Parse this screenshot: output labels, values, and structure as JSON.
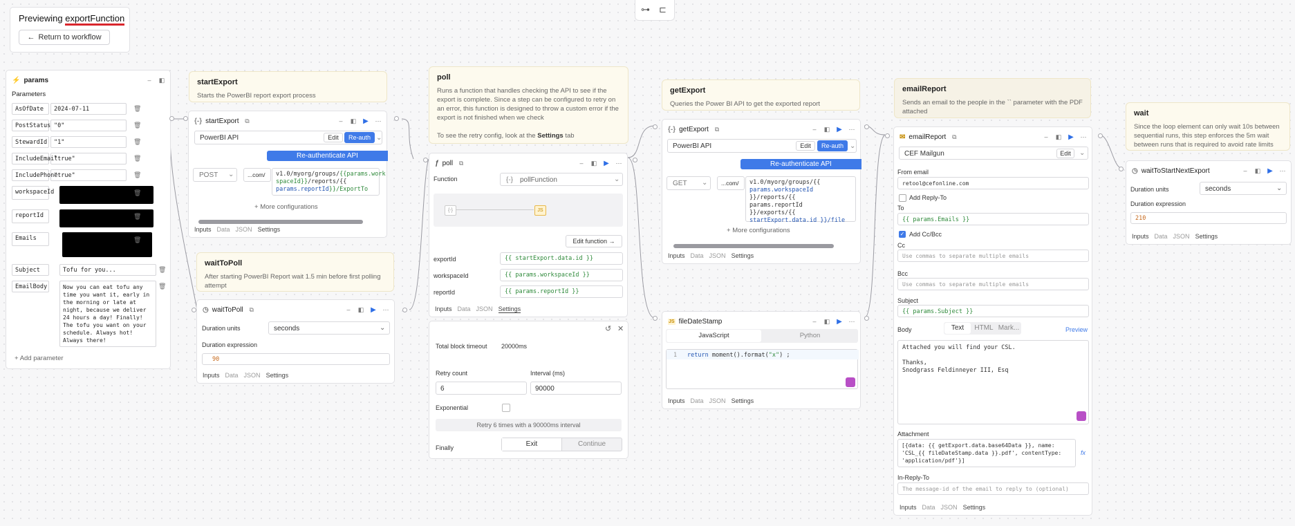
{
  "header": {
    "previewing_label": "Previewing",
    "function_name": "exportFunction",
    "return_label": "Return to workflow"
  },
  "params": {
    "title": "params",
    "section": "Parameters",
    "rows": [
      {
        "key": "AsOfDate",
        "value": "2024-07-11"
      },
      {
        "key": "PostStatus",
        "value": "\"0\""
      },
      {
        "key": "StewardId",
        "value": "\"1\""
      },
      {
        "key": "IncludeEmail",
        "value": "\"true\""
      },
      {
        "key": "IncludePhone",
        "value": "\"true\""
      },
      {
        "key": "workspaceId",
        "value": ""
      },
      {
        "key": "reportId",
        "value": ""
      },
      {
        "key": "Emails",
        "value": ""
      },
      {
        "key": "Subject",
        "value": "Tofu for you..."
      },
      {
        "key": "EmailBody",
        "value": "Now you can eat tofu any time you want it, early in the morning or late at night, because we deliver 24 hours a day! Finally! The tofu you want on your schedule. Always hot! Always there!"
      }
    ],
    "add_param": "Add parameter"
  },
  "notes": {
    "startExport": {
      "title": "startExport",
      "text": "Starts the PowerBI report export process"
    },
    "waitToPoll": {
      "title": "waitToPoll",
      "text": "After starting PowerBI Report wait 1.5 min before first polling attempt"
    },
    "poll": {
      "title": "poll",
      "text": "Runs a function that handles checking the API to see if the export is complete. Since a step can be configured to retry on an error, this function is designed to throw a custom error if the export is not finished when we check\n\nTo see the retry config, look at the"
    },
    "poll_settings_word": "Settings",
    "poll_tab_word": "tab",
    "getExport": {
      "title": "getExport",
      "text": "Queries the Power BI API to get the exported report"
    },
    "emailReport": {
      "title": "emailReport",
      "text": "Sends an email to the people in the `` parameter with the PDF attached"
    },
    "wait": {
      "title": "wait",
      "text": "Since the loop element can only wait 10s between sequential runs, this step enforces the 5m wait between runs that is required to avoid rate limits"
    }
  },
  "startExport": {
    "title": "startExport",
    "resource": "PowerBI API",
    "edit": "Edit",
    "reauth": "Re-auth",
    "banner": "Re-authenticate API",
    "method": "POST",
    "base": "...com/",
    "url_a": "v1.0/myorg/groups/",
    "url_b": "{{params.work",
    "url_c": "spaceId}}",
    "url_d": "/reports/{{",
    "url_e": "params.reportId",
    "url_f": "}}/ExportTo",
    "more": "More configurations",
    "tabs": [
      "Inputs",
      "Data",
      "JSON",
      "Settings"
    ]
  },
  "waitToPoll": {
    "title": "waitToPoll",
    "units_label": "Duration units",
    "units_value": "seconds",
    "expr_label": "Duration expression",
    "expr_value": "90",
    "tabs": [
      "Inputs",
      "Data",
      "JSON",
      "Settings"
    ]
  },
  "poll": {
    "title": "poll",
    "function_label": "Function",
    "function_value": "pollFunction",
    "edit_function": "Edit function",
    "rows": [
      {
        "label": "exportId",
        "value": "{{ startExport.data.id }}"
      },
      {
        "label": "workspaceId",
        "value": "{{ params.workspaceId }}"
      },
      {
        "label": "reportId",
        "value": "{{ params.reportId }}"
      }
    ],
    "tabs": [
      "Inputs",
      "Data",
      "JSON",
      "Settings"
    ]
  },
  "retry": {
    "timeout_label": "Total block timeout",
    "timeout_value": "20000ms",
    "count_label": "Retry count",
    "count_value": "6",
    "interval_label": "Interval (ms)",
    "interval_value": "90000",
    "exponential_label": "Exponential",
    "summary": "Retry 6 times with a 90000ms interval",
    "finally_label": "Finally",
    "exit": "Exit",
    "continue": "Continue"
  },
  "getExport": {
    "title": "getExport",
    "resource": "PowerBI API",
    "edit": "Edit",
    "reauth": "Re-auth",
    "banner": "Re-authenticate API",
    "method": "GET",
    "base": "...com/",
    "url_lines": [
      "v1.0/myorg/groups/{{",
      "params.workspaceId",
      "}}/reports/{{ params.reportId",
      "}}/exports/{{",
      "startExport.data.id }}/file"
    ],
    "more": "More configurations",
    "tabs": [
      "Inputs",
      "Data",
      "JSON",
      "Settings"
    ]
  },
  "fileDateStamp": {
    "title": "fileDateStamp",
    "lang_js": "JavaScript",
    "lang_py": "Python",
    "line_no": "1",
    "code_a": "return",
    "code_b": " moment().format(",
    "code_c": "\"x\"",
    "code_d": ") ;",
    "tabs": [
      "Inputs",
      "Data",
      "JSON",
      "Settings"
    ]
  },
  "emailReport": {
    "title": "emailReport",
    "resource": "CEF Mailgun",
    "edit": "Edit",
    "from_label": "From email",
    "from_value": "retool@cefonline.com",
    "add_reply": "Add Reply-To",
    "to_label": "To",
    "to_value": "{{ params.Emails }}",
    "add_cc": "Add Cc/Bcc",
    "cc_label": "Cc",
    "cc_placeholder": "Use commas to separate multiple emails",
    "bcc_label": "Bcc",
    "bcc_placeholder": "Use commas to separate multiple emails",
    "subject_label": "Subject",
    "subject_value": "{{ params.Subject }}",
    "body_label": "Body",
    "body_tabs": [
      "Text",
      "HTML",
      "Mark..."
    ],
    "preview": "Preview",
    "body_lines": [
      "Attached you will find your CSL.",
      "",
      "Thanks,",
      "Snodgrass Feldinneyer III, Esq"
    ],
    "attachment_label": "Attachment",
    "attachment_lines": [
      "[{data: {{ getExport.data.base64Data }}, name:",
      "'CSL_{{ fileDateStamp.data }}.pdf', contentType:",
      "'application/pdf'}]"
    ],
    "fx": "fx",
    "inreply_label": "In-Reply-To",
    "inreply_placeholder": "The message-id of the email to reply to (optional)",
    "tabs": [
      "Inputs",
      "Data",
      "JSON",
      "Settings"
    ]
  },
  "waitToStartNextExport": {
    "title": "waitToStartNextExport",
    "units_label": "Duration units",
    "units_value": "seconds",
    "expr_label": "Duration expression",
    "expr_value": "210",
    "tabs": [
      "Inputs",
      "Data",
      "JSON",
      "Settings"
    ]
  },
  "colors": {
    "accent": "#3f7ae8",
    "note_bg": "#fdfaee",
    "template_green": "#2f8a3b",
    "underline_red": "#d9262c"
  }
}
